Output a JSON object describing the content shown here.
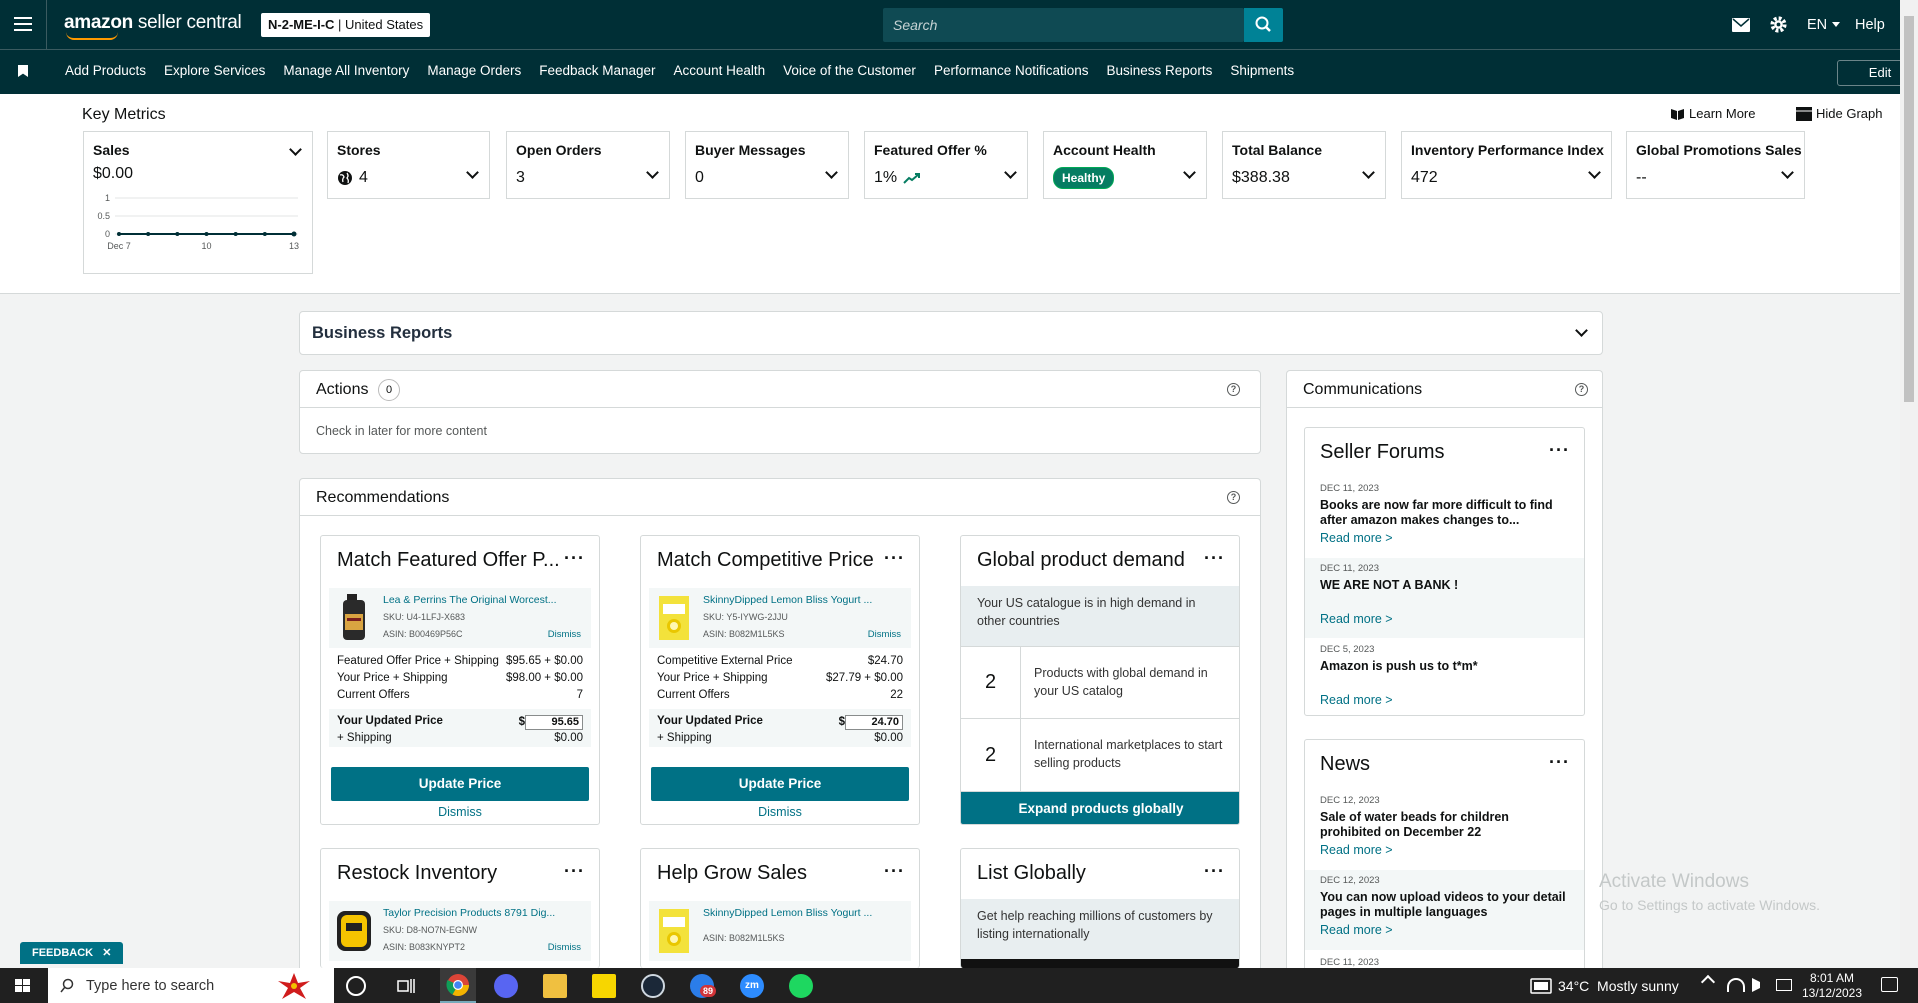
{
  "header": {
    "logo_bold": "amazon",
    "logo_rest": " seller central",
    "account_bold": "N-2-ME-I-C",
    "account_rest": " | United States",
    "search_placeholder": "Search",
    "language": "EN",
    "help": "Help"
  },
  "nav": {
    "items": [
      "Add Products",
      "Explore Services",
      "Manage All Inventory",
      "Manage Orders",
      "Feedback Manager",
      "Account Health",
      "Voice of the Customer",
      "Performance Notifications",
      "Business Reports",
      "Shipments"
    ],
    "edit": "Edit"
  },
  "key_metrics": {
    "title": "Key Metrics",
    "learn_more": "Learn More",
    "hide_graph": "Hide Graph",
    "sales": {
      "label": "Sales",
      "value": "$0.00"
    },
    "cards": [
      {
        "label": "Stores",
        "value": "4"
      },
      {
        "label": "Open Orders",
        "value": "3"
      },
      {
        "label": "Buyer Messages",
        "value": "0"
      },
      {
        "label": "Featured Offer %",
        "value": "1%"
      },
      {
        "label": "Account Health",
        "value": "Healthy"
      },
      {
        "label": "Total Balance",
        "value": "$388.38"
      },
      {
        "label": "Inventory Performance Index",
        "value": "472"
      },
      {
        "label": "Global Promotions Sales",
        "value": "--"
      }
    ]
  },
  "chart_data": {
    "type": "line",
    "x": [
      "Dec 7",
      "8",
      "9",
      "10",
      "11",
      "12",
      "13"
    ],
    "xticks": [
      "Dec 7",
      "10",
      "13"
    ],
    "yticks": [
      "1",
      "0.5",
      "0"
    ],
    "values": [
      0,
      0,
      0,
      0,
      0,
      0,
      0
    ],
    "ylim": [
      0,
      1
    ],
    "title": "",
    "xlabel": "",
    "ylabel": ""
  },
  "business_reports": {
    "title": "Business Reports"
  },
  "actions": {
    "title": "Actions",
    "count": "0",
    "empty": "Check in later for more content"
  },
  "recommendations": {
    "title": "Recommendations",
    "match_featured": {
      "title": "Match Featured Offer P...",
      "product": "Lea & Perrins The Original Worcest...",
      "sku": "SKU: U4-1LFJ-X683",
      "asin": "ASIN: B00469P56C",
      "dismiss_small": "Dismiss",
      "rows": [
        {
          "label": "Featured Offer Price + Shipping",
          "value": "$95.65 + $0.00"
        },
        {
          "label": "Your Price + Shipping",
          "value": "$98.00 + $0.00"
        },
        {
          "label": "Current Offers",
          "value": "7"
        }
      ],
      "updated_label": "Your Updated Price",
      "updated_value": "95.65",
      "shipping_label": "+ Shipping",
      "shipping_value": "$0.00",
      "button": "Update Price",
      "dismiss": "Dismiss"
    },
    "match_competitive": {
      "title": "Match Competitive Price",
      "product": "SkinnyDipped Lemon Bliss Yogurt ...",
      "sku": "SKU: Y5-IYWG-2JJU",
      "asin": "ASIN: B082M1L5KS",
      "dismiss_small": "Dismiss",
      "rows": [
        {
          "label": "Competitive External Price",
          "value": "$24.70"
        },
        {
          "label": "Your Price + Shipping",
          "value": "$27.79 + $0.00"
        },
        {
          "label": "Current Offers",
          "value": "22"
        }
      ],
      "updated_label": "Your Updated Price",
      "updated_value": "24.70",
      "shipping_label": "+ Shipping",
      "shipping_value": "$0.00",
      "button": "Update Price",
      "dismiss": "Dismiss"
    },
    "global_demand": {
      "title": "Global product demand",
      "desc": "Your US catalogue is in high demand in other countries",
      "stat1_num": "2",
      "stat1_text": "Products with global demand in your US catalog",
      "stat2_num": "2",
      "stat2_text": "International marketplaces to start selling products",
      "button": "Expand products globally"
    },
    "restock": {
      "title": "Restock Inventory",
      "product": "Taylor Precision Products 8791 Dig...",
      "sku": "SKU: D8-NO7N-EGNW",
      "asin": "ASIN: B083KNYPT2",
      "dismiss_small": "Dismiss"
    },
    "grow_sales": {
      "title": "Help Grow Sales",
      "product": "SkinnyDipped Lemon Bliss Yogurt ...",
      "asin": "ASIN: B082M1L5KS"
    },
    "list_globally": {
      "title": "List Globally",
      "desc": "Get help reaching millions of customers by listing internationally"
    }
  },
  "communications": {
    "title": "Communications",
    "forums": {
      "title": "Seller Forums",
      "items": [
        {
          "date": "DEC 11, 2023",
          "title": "Books are now far more difficult to find after amazon makes changes to...",
          "read": "Read more >"
        },
        {
          "date": "DEC 11, 2023",
          "title": "WE ARE NOT A BANK !",
          "read": "Read more >"
        },
        {
          "date": "DEC 5, 2023",
          "title": "Amazon is push us to t*m*",
          "read": "Read more >"
        }
      ]
    },
    "news": {
      "title": "News",
      "items": [
        {
          "date": "DEC 12, 2023",
          "title": "Sale of water beads for children prohibited on December 22",
          "read": "Read more >"
        },
        {
          "date": "DEC 12, 2023",
          "title": "You can now upload videos to your detail pages in multiple languages",
          "read": "Read more >"
        },
        {
          "date": "DEC 11, 2023"
        }
      ]
    }
  },
  "feedback": "FEEDBACK",
  "watermark": {
    "title": "Activate Windows",
    "sub": "Go to Settings to activate Windows."
  },
  "taskbar": {
    "search": "Type here to search",
    "weather": "34°C  Mostly sunny",
    "time": "8:01 AM",
    "date": "13/12/2023",
    "badge": "89"
  }
}
